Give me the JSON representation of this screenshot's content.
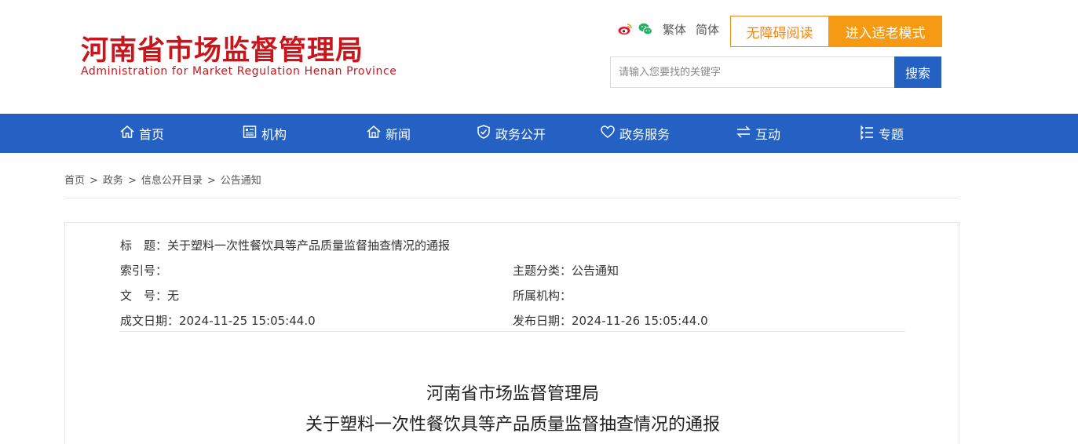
{
  "header": {
    "title": "河南省市场监督管理局",
    "subtitle": "Administration for Market Regulation Henan Province",
    "traditional_label": "繁体",
    "simplified_label": "简体",
    "accessible_label": "无障碍阅读",
    "elder_mode_label": "进入适老模式",
    "search_placeholder": "请输入您要找的关键字",
    "search_button_label": "搜索"
  },
  "colors": {
    "brand_red": "#c8161d",
    "nav_blue": "#2461c3",
    "orange": "#f59a12"
  },
  "nav": {
    "items": [
      {
        "label": "首页",
        "icon": "home-icon"
      },
      {
        "label": "机构",
        "icon": "org-icon"
      },
      {
        "label": "新闻",
        "icon": "news-icon"
      },
      {
        "label": "政务公开",
        "icon": "shield-icon"
      },
      {
        "label": "政务服务",
        "icon": "heart-icon"
      },
      {
        "label": "互动",
        "icon": "exchange-icon"
      },
      {
        "label": "专题",
        "icon": "list-icon"
      }
    ]
  },
  "breadcrumb": {
    "items": [
      "首页",
      "政务",
      "信息公开目录",
      "公告通知"
    ],
    "separator": ">"
  },
  "article": {
    "meta": {
      "title_label": "标　题：",
      "title_value": "关于塑料一次性餐饮具等产品质量监督抽查情况的通报",
      "index_label": "索引号：",
      "index_value": "",
      "category_label": "主题分类：",
      "category_value": "公告通知",
      "doc_no_label": "文　号：",
      "doc_no_value": "无",
      "org_label": "所属机构：",
      "org_value": "",
      "created_label": "成文日期：",
      "created_value": "2024-11-25 15:05:44.0",
      "published_label": "发布日期：",
      "published_value": "2024-11-26 15:05:44.0"
    },
    "heading_line1": "河南省市场监督管理局",
    "heading_line2": "关于塑料一次性餐饮具等产品质量监督抽查情况的通报"
  }
}
